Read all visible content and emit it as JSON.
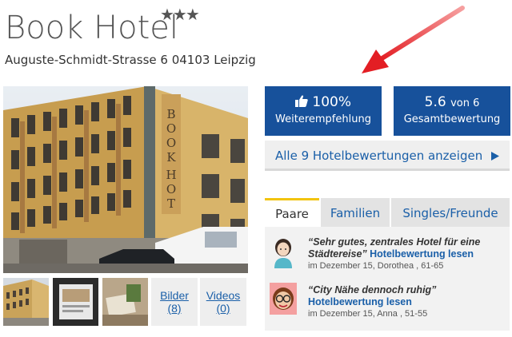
{
  "hotel": {
    "name": "Book Hotel",
    "stars": "★★★",
    "address": "Auguste-Schmidt-Strasse 6 04103 Leipzig"
  },
  "photo": {
    "sign_text": "BOOK HOTEL"
  },
  "media_links": {
    "bilder_label": "Bilder",
    "bilder_count": "(8)",
    "videos_label": "Videos",
    "videos_count": "(0)"
  },
  "stats": {
    "recommend_icon": "thumbs-up-icon",
    "recommend_value": "100%",
    "recommend_label": "Weiterempfehlung",
    "rating_value": "5.6",
    "rating_suffix": "von 6",
    "rating_label": "Gesamtbewertung"
  },
  "all_reviews": {
    "label": "Alle 9 Hotelbewertungen anzeigen",
    "icon": "triangle-right-icon"
  },
  "tabs": [
    {
      "label": "Paare",
      "active": true
    },
    {
      "label": "Familien",
      "active": false
    },
    {
      "label": "Singles/Freunde",
      "active": false
    }
  ],
  "reviews": [
    {
      "quote": "“Sehr gutes, zentrales Hotel für eine Städtereise”",
      "link": "Hotelbewertung lesen",
      "meta": "im Dezember 15, Dorothea , 61-65"
    },
    {
      "quote": "“City Nähe dennoch ruhig”",
      "link": "Hotelbewertung lesen",
      "meta": "im Dezember 15, Anna , 51-55"
    }
  ],
  "colors": {
    "accent_blue": "#17519b",
    "link_blue": "#1a5fa8",
    "tab_highlight": "#f2c40f",
    "arrow_red": "#e31e24"
  }
}
